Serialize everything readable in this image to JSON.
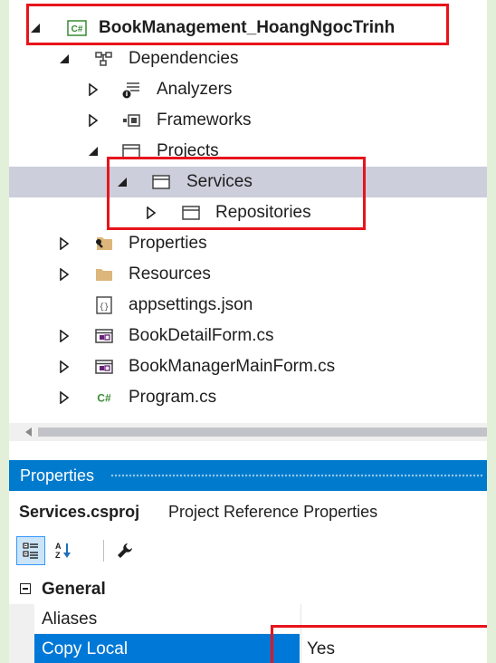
{
  "tree": {
    "project": "BookManagement_HoangNgocTrinh",
    "dependencies": "Dependencies",
    "analyzers": "Analyzers",
    "frameworks": "Frameworks",
    "projects": "Projects",
    "services": "Services",
    "repositories": "Repositories",
    "properties": "Properties",
    "resources": "Resources",
    "appsettings": "appsettings.json",
    "book_detail_form": "BookDetailForm.cs",
    "book_manager_main_form": "BookManagerMainForm.cs",
    "program": "Program.cs"
  },
  "properties_pane": {
    "title": "Properties",
    "object_name": "Services.csproj",
    "object_kind": "Project Reference Properties",
    "category": "General",
    "rows": [
      {
        "name": "Aliases",
        "value": ""
      },
      {
        "name": "Copy Local",
        "value": "Yes"
      }
    ]
  },
  "colors": {
    "accent": "#007acc",
    "selection": "#0078d7",
    "tree_selection": "#cccedb",
    "highlight_box": "#e8141b",
    "csharp_icon": "#388a34",
    "folder_icon": "#dcb67a",
    "form_icon": "#68217a"
  }
}
